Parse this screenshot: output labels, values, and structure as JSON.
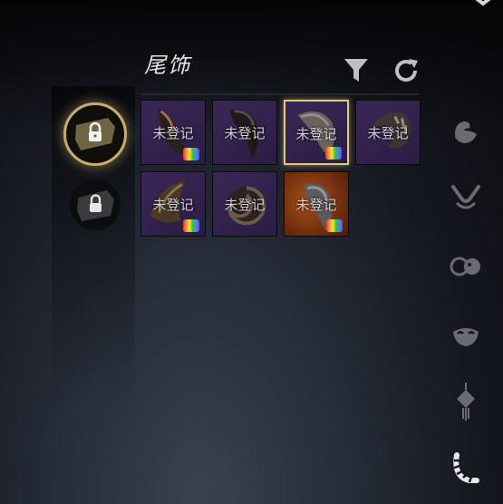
{
  "header": {
    "title": "尾饰"
  },
  "items": [
    {
      "status": "未登记",
      "variant": "purple",
      "selected": false,
      "badge": true
    },
    {
      "status": "未登记",
      "variant": "purple",
      "selected": false,
      "badge": false
    },
    {
      "status": "未登记",
      "variant": "purple",
      "selected": true,
      "badge": true
    },
    {
      "status": "未登记",
      "variant": "purple",
      "selected": false,
      "badge": false
    },
    {
      "status": "未登记",
      "variant": "purple",
      "selected": false,
      "badge": true
    },
    {
      "status": "未登记",
      "variant": "purple",
      "selected": false,
      "badge": false
    },
    {
      "status": "未登记",
      "variant": "orange",
      "selected": false,
      "badge": true
    }
  ],
  "left_tabs": [
    {
      "icon": "lock-icon",
      "active": true
    },
    {
      "icon": "lock-icon",
      "active": false
    }
  ],
  "right_categories": [
    "swan-icon",
    "rabbit-ears-icon",
    "twin-masks-icon",
    "mask-icon",
    "pendant-icon",
    "tail-icon"
  ],
  "colors": {
    "accent_gold": "#c8ad6a",
    "slot_purple": "#3b2757",
    "slot_orange": "#a6511b"
  }
}
